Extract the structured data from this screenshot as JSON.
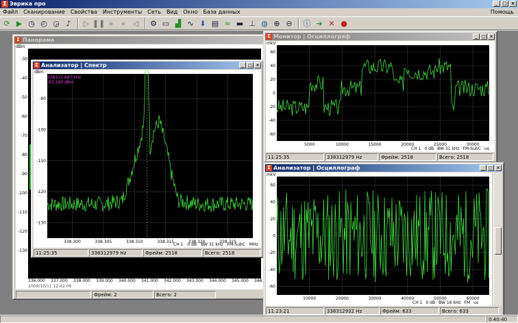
{
  "app": {
    "title": "Эврика про",
    "logo": "Σ"
  },
  "menu": [
    "Файл",
    "Сканирование",
    "Свойства",
    "Инструменты",
    "Сеть",
    "Вид",
    "Окно",
    "База данных"
  ],
  "help": "Помощь",
  "toolbar_icons": [
    "refresh-icon",
    "play-icon",
    "stopwatch-icon",
    "history-icon",
    "timer-icon",
    "microphone-icon",
    "step-forward-icon",
    "pause-icon",
    "fast-forward-icon",
    "rewind-icon",
    "back-icon",
    "settings-icon",
    "window-icon",
    "chart-icon",
    "spectrum-icon",
    "download-icon",
    "scan-icon",
    "oscilloscope-icon",
    "display-icon",
    "antenna-icon",
    "globe-icon",
    "zoom-in-icon",
    "zoom-out-icon",
    "info-icon",
    "arrow-icon",
    "close-icon",
    "record-icon"
  ],
  "panorama": {
    "title": "Панорама",
    "unit": "dBm",
    "yticks": [
      "-30",
      "-40",
      "-50",
      "-60",
      "-70",
      "-80",
      "-90",
      "-100",
      "-110",
      "-120",
      "-130"
    ],
    "xticks": [
      "336.000",
      "337.000",
      "338.000",
      "339.000",
      "340.000",
      "341.000",
      "342.000",
      "343.000",
      "344.000",
      "345.000",
      "346.000"
    ],
    "date": "2009/10/11 12:42:06",
    "status": {
      "frame": "Фрейм: 2",
      "total": "Всего: 2"
    }
  },
  "spectrum": {
    "title": "Анализатор | Спектр",
    "unit": "dBm",
    "marker_freq": "338312.687 kHz",
    "marker_level": "-63.290 dBm",
    "channel": "CH 1",
    "gain": "0 dB",
    "bw": "BW 31 kHz",
    "mode": "FM-SubC",
    "xunit": "MHz",
    "status": {
      "time": "11:25:35",
      "freq": "338312979 Hz",
      "frame": "Фрейм: 2518",
      "total": "Всего: 2518"
    },
    "chart_data": {
      "type": "line",
      "ylabel": "dBm",
      "xlabel": "MHz",
      "xlim": [
        338.296,
        338.329
      ],
      "ylim": [
        -135,
        -82
      ],
      "xticks": [
        338.3,
        338.305,
        338.31,
        338.315,
        338.32,
        338.325
      ],
      "yticks": [
        -90,
        -100,
        -110,
        -120,
        -130
      ],
      "x": [
        338.296,
        338.3,
        338.305,
        338.308,
        338.309,
        338.31,
        338.311,
        338.3115,
        338.312,
        338.3125,
        338.313,
        338.314,
        338.315,
        338.316,
        338.317,
        338.32,
        338.325,
        338.329
      ],
      "y": [
        -124,
        -124,
        -124,
        -123,
        -117,
        -110,
        -103,
        -98,
        -64,
        -106,
        -101,
        -97,
        -105,
        -115,
        -123,
        -124,
        -124,
        -124
      ]
    }
  },
  "monitor": {
    "title": "Монитор | Осциллограф",
    "unit": "mkV",
    "yticks": [
      "60",
      "40",
      "20",
      "0",
      "-20",
      "-40",
      "-60"
    ],
    "xticks": [
      "5000",
      "10000",
      "15000",
      "20000",
      "25000",
      "30000"
    ],
    "channel": "CH 1",
    "gain": "0 dB",
    "bw": "BW 31 kHz",
    "mode": "FM-SubC",
    "xunit": "us",
    "status": {
      "time": "11:25:35",
      "freq": "338312979 Hz",
      "frame": "Фрейм: 2518",
      "total": "Всего: 2518"
    }
  },
  "analyzer2": {
    "title": "Анализатор | Осциллограф",
    "unit": "mkV",
    "yticks": [
      "60",
      "40",
      "20",
      "0",
      "-20",
      "-40",
      "-60"
    ],
    "xticks": [
      "10000",
      "20000",
      "30000",
      "40000",
      "50000",
      "60000"
    ],
    "channel": "CH 1",
    "gain": "0 dB",
    "bw": "BW 16 kHz",
    "mode": "FM",
    "xunit": "us",
    "status": {
      "time": "11:23:21",
      "freq": "338312932 Hz",
      "frame": "Фрейм: 633",
      "total": "Всего: 633"
    }
  },
  "clock": "0:40:40"
}
